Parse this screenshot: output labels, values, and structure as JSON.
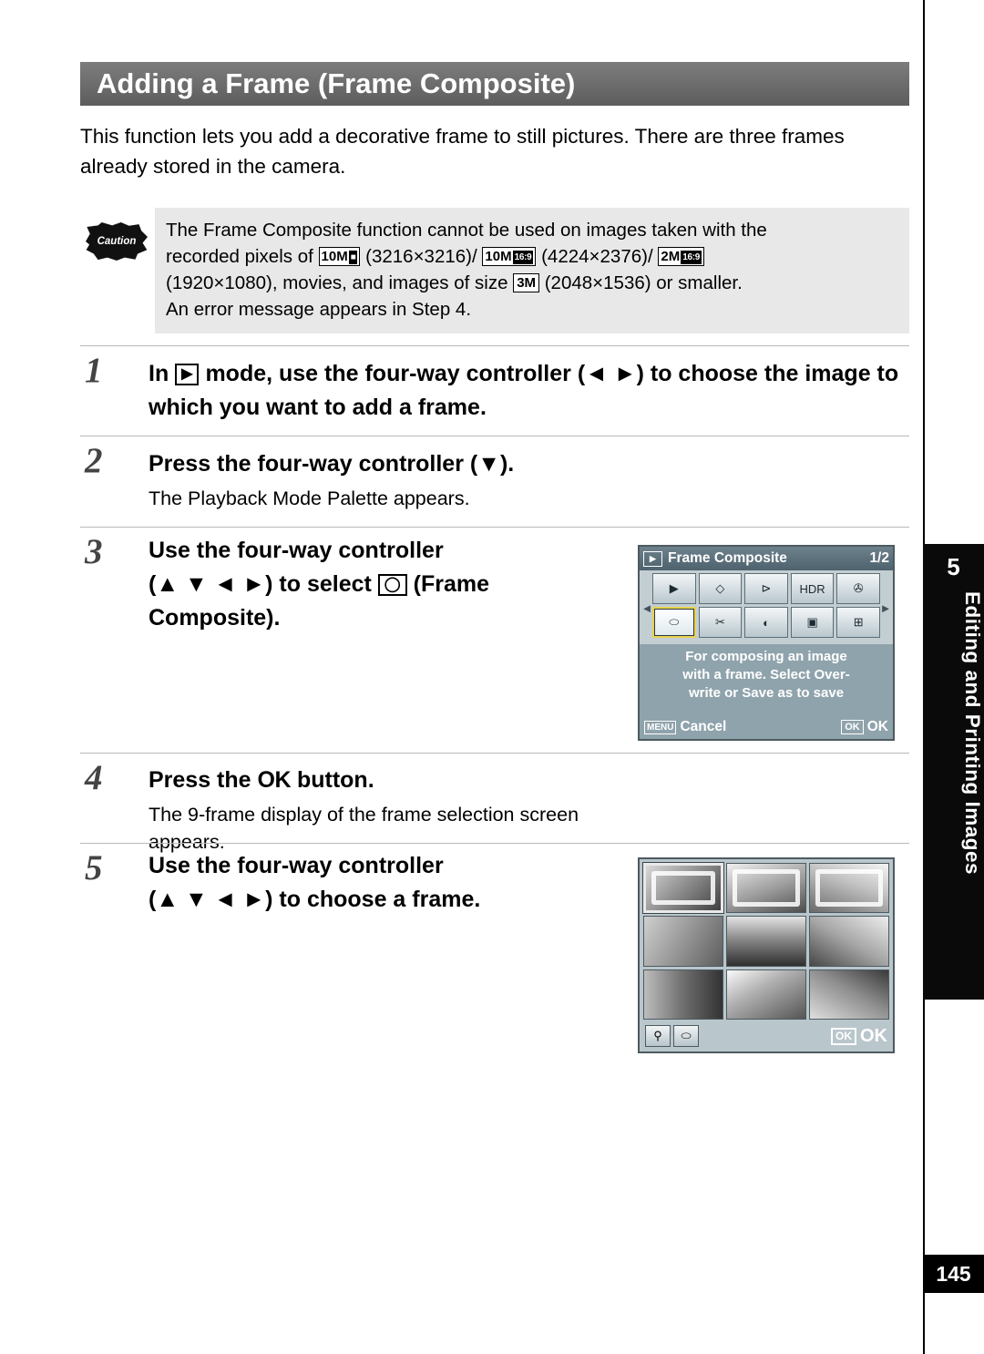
{
  "header": {
    "title": "Adding a Frame (Frame Composite)"
  },
  "intro": "This function lets you add a decorative frame to still pictures. There are three frames already stored in the camera.",
  "caution": {
    "badge_label": "Caution",
    "line1_a": "The Frame Composite function cannot be used on images taken with the",
    "line2_a": "recorded pixels of",
    "badge1": {
      "size": "10",
      "unit": "M",
      "inv": "⬛"
    },
    "line2_b": "(3216×3216)/",
    "badge2": {
      "size": "10",
      "unit": "M",
      "inv": "16:9"
    },
    "line2_c": "(4224×2376)/",
    "badge3": {
      "size": "2",
      "unit": "M",
      "inv": "16:9"
    },
    "line3_a": "(1920×1080), movies, and images of size",
    "badge4": {
      "size": "3",
      "unit": "M"
    },
    "line3_b": "(2048×1536) or smaller.",
    "line4": "An error message appears in Step 4."
  },
  "steps": [
    {
      "num": "1",
      "head_a": "In",
      "head_icon": "playback-mode-icon",
      "head_b": "mode, use the four-way controller (",
      "head_arrows": "◄ ►",
      "head_c": ") to choose the image to which you want to add a frame.",
      "sub": ""
    },
    {
      "num": "2",
      "head_a": "Press the four-way controller (",
      "head_arrows": "▼",
      "head_c": ").",
      "sub": "The Playback Mode Palette appears."
    },
    {
      "num": "3",
      "head_line1": "Use the four-way controller",
      "head_line2_a": "(",
      "head_arrows": "▲ ▼ ◄ ►",
      "head_line2_b": ") to select",
      "head_icon": "frame-composite-icon",
      "head_line2_c": "(Frame",
      "head_line3": "Composite).",
      "sub": ""
    },
    {
      "num": "4",
      "head_a": "Press the",
      "head_ok": "OK",
      "head_b": "button.",
      "sub": "The 9-frame display of the frame selection screen appears."
    },
    {
      "num": "5",
      "head_line1": "Use the four-way controller",
      "head_line2_a": "(",
      "head_arrows": "▲ ▼ ◄ ►",
      "head_line2_b": ") to choose a frame.",
      "sub": ""
    }
  ],
  "camera_screen_1": {
    "title": "Frame Composite",
    "page_indicator": "1/2",
    "left_arrow": "◄",
    "right_arrow": "►",
    "icons_row1": [
      "▶",
      "◇",
      "⊳",
      "HDR",
      "✇"
    ],
    "icons_row2": [
      "⬭",
      "✂",
      "◐",
      "▣",
      "⊞"
    ],
    "description_line1": "For composing an image",
    "description_line2": "with a frame. Select Over-",
    "description_line3": "write or Save as to save",
    "menu_key": "MENU",
    "cancel_label": "Cancel",
    "ok_key": "OK",
    "ok_label": "OK"
  },
  "camera_screen_2": {
    "zoom_icon": "⚲",
    "mode_icon": "⬭",
    "ok_key": "OK",
    "ok_label": "OK",
    "selected_index": 0
  },
  "side_tab": {
    "number": "5",
    "text": "Editing and Printing Images"
  },
  "page_number": "145",
  "colors": {
    "title_bar": "#6b6b6b",
    "caution_bg": "#e8e8e8",
    "side_tab_bg": "#0a0a0a",
    "camera_bg": "#8fa3ac"
  }
}
